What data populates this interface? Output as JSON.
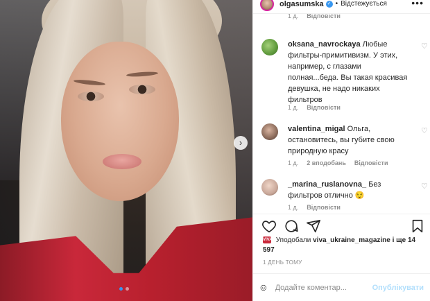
{
  "header": {
    "username": "olgasumska",
    "separator": "•",
    "follow_state": "Відстежується",
    "more_label": "•••"
  },
  "comments": [
    {
      "username": "oksana_navrockaya",
      "text": "Любые фильтры-примитивизм. У этих, например, с глазами полная...беда. Вы такая красивая девушка, не надо никаких фильтров",
      "age": "1 д.",
      "likes": "",
      "reply_label": "Відповісти",
      "avatar_color": "#7fae5c"
    },
    {
      "username": "valentina_migal",
      "text": "Ольга, остановитесь, вы губите свою природную красу",
      "age": "1 д.",
      "likes": "2 вподобань",
      "reply_label": "Відповісти",
      "avatar_color": "#8a6a5a"
    },
    {
      "username": "_marina_ruslanovna_",
      "text": "Без фильтров отлично 😌",
      "age": "1 д.",
      "likes": "",
      "reply_label": "Відповісти",
      "avatar_color": "#c9a89a"
    }
  ],
  "top_meta": {
    "age": "1 д.",
    "reply_label": "Відповісти"
  },
  "likes": {
    "badge": "VIVA!",
    "prefix": "Уподобали",
    "user": "viva_ukraine_magazine",
    "suffix": "і ще 14 597"
  },
  "timestamp": "1 ДЕНЬ ТОМУ",
  "add_comment": {
    "placeholder": "Додайте коментар...",
    "publish_label": "Опублікувати"
  },
  "colors": {
    "accent": "#3897f0",
    "publish_disabled": "#b2dffc",
    "meta": "#8e8e8e"
  },
  "icons": [
    "heart-icon",
    "comment-icon",
    "share-icon",
    "bookmark-icon",
    "emoji-icon",
    "verified-icon",
    "chevron-right-icon"
  ]
}
